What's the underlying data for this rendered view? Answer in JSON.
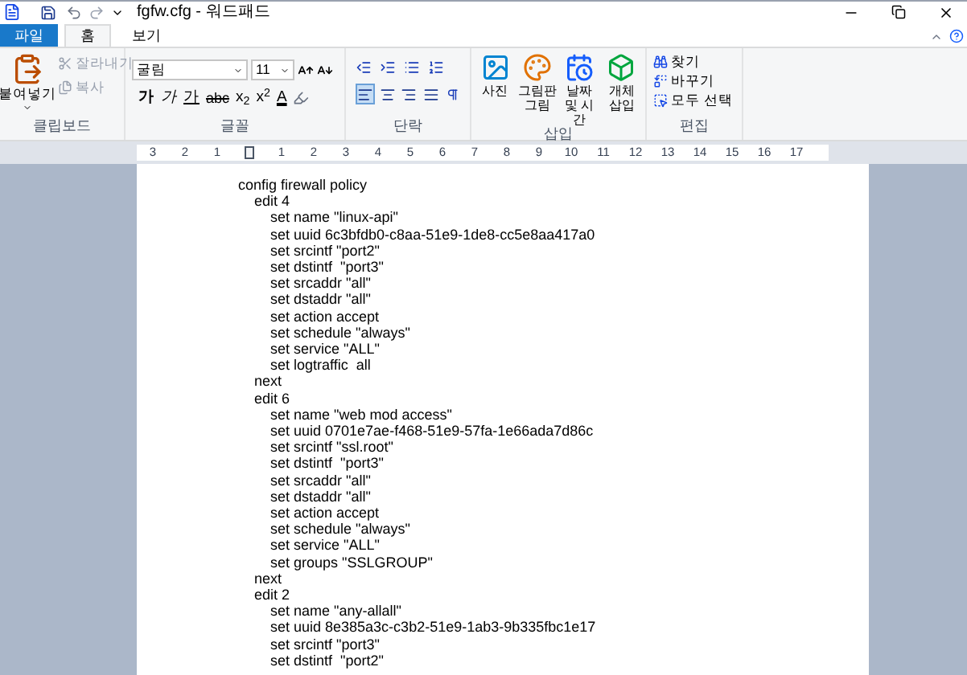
{
  "window": {
    "title": "fgfw.cfg - 워드패드"
  },
  "tabs": [
    {
      "label": "파일",
      "kind": "file",
      "selected": false
    },
    {
      "label": "홈",
      "kind": "tab",
      "selected": true
    },
    {
      "label": "보기",
      "kind": "tab",
      "selected": false
    }
  ],
  "clipboard": {
    "label": "클립보드",
    "paste": "붙여넣기",
    "cut": {
      "label": "잘라내기",
      "disabled": true
    },
    "copy": {
      "label": "복사",
      "disabled": true
    }
  },
  "font": {
    "label": "글꼴",
    "family": "굴림",
    "size": "11",
    "format_buttons": [
      {
        "text": "가",
        "kind": "bold"
      },
      {
        "text": "가",
        "kind": "italic"
      },
      {
        "text": "가",
        "kind": "underline"
      },
      {
        "text": "abc",
        "kind": "strike"
      },
      {
        "text": "x$_{2}$",
        "kind": "sub"
      },
      {
        "text": "x$^{2}$",
        "kind": "sup"
      },
      {
        "text": "A",
        "kind": "color"
      }
    ]
  },
  "paragraph": {
    "label": "단락",
    "alignment": [
      {
        "selected": true
      },
      {
        "selected": false
      },
      {
        "selected": false
      },
      {
        "selected": false
      }
    ]
  },
  "insert": {
    "label": "삽입",
    "items": [
      {
        "label": "사진",
        "kind": "picture"
      },
      {
        "label": "그림판 그림",
        "kind": "paint"
      },
      {
        "label": "날짜 및 시간",
        "kind": "date"
      },
      {
        "label": "개체 삽입",
        "kind": "object"
      }
    ]
  },
  "editing": {
    "label": "편집",
    "items": [
      {
        "label": "찾기",
        "kind": "find"
      },
      {
        "label": "바꾸기",
        "kind": "replace"
      },
      {
        "label": "모두 선택",
        "kind": "select"
      }
    ]
  },
  "ruler": [
    "3",
    "2",
    "1",
    "1",
    "2",
    "3",
    "4",
    "5",
    "6",
    "7",
    "8",
    "9",
    "10",
    "11",
    "12",
    "13",
    "14",
    "15",
    "16",
    "17"
  ],
  "document": [
    {
      "text": "config firewall policy",
      "children": [
        {
          "text": "edit 4",
          "children": [
            {
              "text": "set name \"linux-api\""
            },
            {
              "text": "set uuid 6c3bfdb0-c8aa-51e9-1de8-cc5e8aa417a0"
            },
            {
              "text": "set srcintf \"port2\""
            },
            {
              "text": "set dstintf  \"port3\""
            },
            {
              "text": "set srcaddr \"all\""
            },
            {
              "text": "set dstaddr \"all\""
            },
            {
              "text": "set action accept"
            },
            {
              "text": "set schedule \"always\""
            },
            {
              "text": "set service \"ALL\""
            },
            {
              "text": "set logtraffic  all"
            }
          ]
        },
        {
          "text": "next"
        },
        {
          "text": "edit 6",
          "children": [
            {
              "text": "set name \"web mod access\""
            },
            {
              "text": "set uuid 0701e7ae-f468-51e9-57fa-1e66ada7d86c"
            },
            {
              "text": "set srcintf \"ssl.root\""
            },
            {
              "text": "set dstintf  \"port3\""
            },
            {
              "text": "set srcaddr \"all\""
            },
            {
              "text": "set dstaddr \"all\""
            },
            {
              "text": "set action accept"
            },
            {
              "text": "set schedule \"always\""
            },
            {
              "text": "set service \"ALL\""
            },
            {
              "text": "set groups \"SSLGROUP\""
            }
          ]
        },
        {
          "text": "next"
        },
        {
          "text": "edit 2",
          "children": [
            {
              "text": "set name \"any-allall\""
            },
            {
              "text": "set uuid 8e385a3c-c3b2-51e9-1ab3-9b335fbc1e17"
            },
            {
              "text": "set srcintf \"port3\""
            },
            {
              "text": "set dstintf  \"port2\""
            }
          ]
        }
      ]
    }
  ]
}
